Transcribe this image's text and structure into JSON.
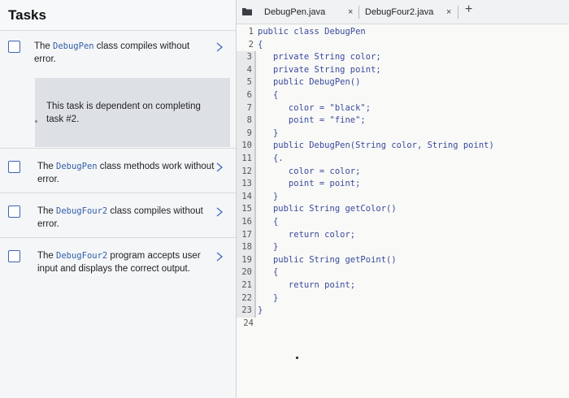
{
  "tasks_panel": {
    "title": "Tasks",
    "tasks": [
      {
        "prefix": "The ",
        "code": "DebugPen",
        "suffix": " class compiles without error."
      },
      {
        "prefix": "The ",
        "code": "DebugPen",
        "suffix": " class methods work without error."
      },
      {
        "prefix": "The ",
        "code": "DebugFour2",
        "suffix": " class compiles without error."
      },
      {
        "prefix": "The ",
        "code": "DebugFour2",
        "suffix": " program accepts user input and displays the correct output."
      }
    ],
    "dependency_note": "This task is dependent on completing task #2."
  },
  "editor": {
    "tabs": [
      {
        "label": "DebugPen.java",
        "close": "×"
      },
      {
        "label": "DebugFour2.java",
        "close": "×"
      }
    ],
    "add_tab": "+",
    "lines": [
      "public class DebugPen",
      "{",
      "   private String color;",
      "   private String point;",
      "   public DebugPen()",
      "   {",
      "      color = \"black\";",
      "      point = \"fine\";",
      "   }",
      "   public DebugPen(String color, String point)",
      "   {.",
      "      color = color;",
      "      point = point;",
      "   }",
      "   public String getColor()",
      "   {",
      "      return color;",
      "   }",
      "   public String getPoint()",
      "   {",
      "      return point;",
      "   }",
      "}",
      ""
    ],
    "line_numbers": [
      "1",
      "2",
      "3",
      "4",
      "5",
      "6",
      "7",
      "8",
      "9",
      "10",
      "11",
      "12",
      "13",
      "14",
      "15",
      "16",
      "17",
      "18",
      "19",
      "20",
      "21",
      "22",
      "23",
      "24"
    ]
  }
}
